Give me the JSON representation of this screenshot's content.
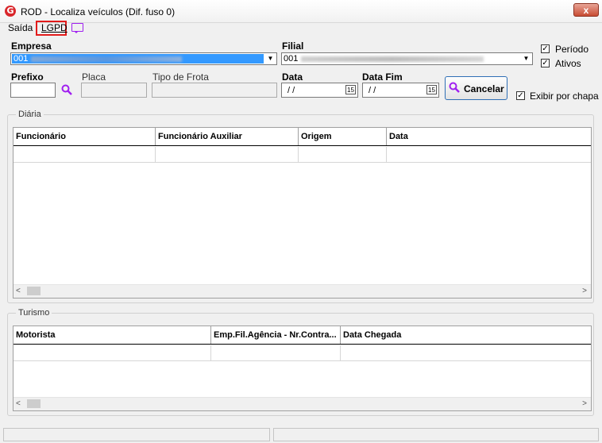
{
  "window": {
    "title": "ROD - Localiza veículos (Dif. fuso 0)",
    "logo_letter": "G",
    "close_label": "x"
  },
  "menu": {
    "exit": "Saída",
    "lgpd": "LGPD"
  },
  "form": {
    "empresa_label": "Empresa",
    "empresa_value": "001",
    "filial_label": "Filial",
    "filial_value": "001",
    "prefixo_label": "Prefixo",
    "placa_label": "Placa",
    "tipo_frota_label": "Tipo de Frota",
    "data_label": "Data",
    "data_value": " / /",
    "data_fim_label": "Data Fim",
    "data_fim_value": " / /",
    "calendar_glyph": "15",
    "cancel_label": "Cancelar",
    "periodo_label": "Período",
    "periodo_checked": true,
    "ativos_label": "Ativos",
    "ativos_checked": true,
    "exibir_chapa_label": "Exibir por chapa",
    "exibir_chapa_checked": true
  },
  "diaria": {
    "title": "Diária",
    "columns": [
      "Funcionário",
      "Funcionário Auxiliar",
      "Origem",
      "Data"
    ]
  },
  "turismo": {
    "title": "Turismo",
    "columns": [
      "Motorista",
      "Emp.Fil.Agência - Nr.Contra...",
      "Data Chegada"
    ]
  },
  "scroll": {
    "left": "<",
    "right": ">"
  },
  "colors": {
    "selection": "#3399ff",
    "lgpd_highlight": "#e21b1b",
    "icon_purple": "#a020f0",
    "close_red": "#c84c33"
  },
  "icons": [
    "app-logo-icon",
    "chat-icon",
    "search-icon",
    "calendar-icon",
    "close-icon",
    "chevron-down-icon",
    "checkbox-icon"
  ]
}
